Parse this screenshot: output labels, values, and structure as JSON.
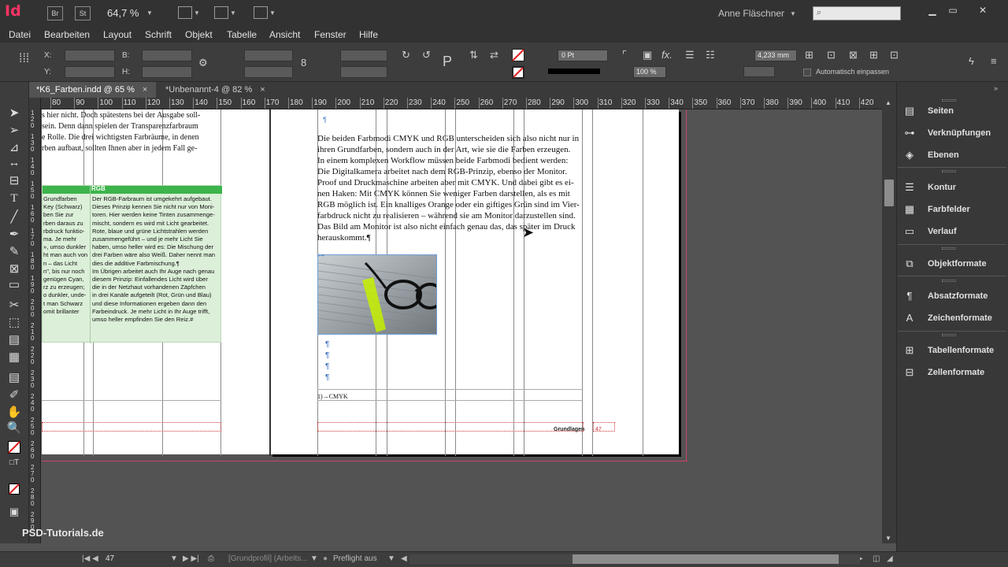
{
  "app": {
    "logo": "Id",
    "bridge_label": "Br",
    "stock_label": "St",
    "zoom": "64,7 %",
    "user": "Anne Fläschner"
  },
  "menu": [
    "Datei",
    "Bearbeiten",
    "Layout",
    "Schrift",
    "Objekt",
    "Tabelle",
    "Ansicht",
    "Fenster",
    "Hilfe"
  ],
  "control": {
    "x_label": "X:",
    "y_label": "Y:",
    "b_label": "B:",
    "h_label": "H:",
    "stroke_value": "0 Pt",
    "percent_value": "100 %",
    "size_value": "4,233 mm",
    "auto_fit_label": "Automatisch einpassen"
  },
  "tabs": [
    {
      "label": "*K6_Farben.indd @ 65 %",
      "active": true
    },
    {
      "label": "*Unbenannt-4 @ 82 %",
      "active": false
    }
  ],
  "ruler_h": [
    "80",
    "90",
    "100",
    "110",
    "120",
    "130",
    "140",
    "150",
    "160",
    "170",
    "180",
    "190",
    "200",
    "210",
    "220",
    "230",
    "240",
    "250",
    "260",
    "270",
    "280",
    "290",
    "300",
    "310",
    "320",
    "330",
    "340",
    "350",
    "360",
    "370",
    "380",
    "390",
    "400",
    "410",
    "420"
  ],
  "ruler_v": [
    "1 2 0",
    "1 3 0",
    "1 4 0",
    "1 5 0",
    "1 6 0",
    "1 7 0",
    "1 8 0",
    "1 9 0",
    "2 0 0",
    "2 1 0",
    "2 2 0",
    "2 3 0",
    "2 4 0",
    "2 5 0",
    "2 6 0",
    "2 7 0",
    "2 8 0",
    "2 9 0"
  ],
  "left_page": {
    "lines": [
      "s hier nicht. Doch spätestens bei der Ausgabe soll-",
      "sein. Denn dann spielen der Transparenzfarbraum",
      "e Rolle. Die drei wichtigsten Farbräume, in denen",
      "rben aufbaut, sollten Ihnen aber in jedem Fall ge-"
    ],
    "table_header": "RGB",
    "table_left": [
      "Grundfarben",
      "Key (Schwarz)",
      "ben Sie zur",
      "rben daraus zu",
      "rbdruck funktio-",
      "ma. Je mehr",
      "», umso dunkler",
      "ht man auch von",
      "n – das Licht",
      "n\", bis nur noch",
      "genügen Cyan,",
      "rz zu erzeugen;",
      "o dunkler, unde-",
      "t man Schwarz",
      "omit brillanter"
    ],
    "table_right": [
      "Der RGB-Farbraum ist umgekehrt aufgebaut.",
      "Dieses Prinzip kennen Sie nicht nur von Moni-",
      "toren. Hier werden keine Tinten zusammenge-",
      "mischt, sondern es wird mit Licht gearbeitet.",
      "Rote, blaue und grüne Lichtstrahlen werden",
      "zusammengeführt – und je mehr Licht Sie",
      "haben, umso heller wird es: Die Mischung der",
      "drei Farben wäre also Weiß. Daher nennt man",
      "dies die additive Farbmischung.¶",
      "Im Übrigen arbeitet auch Ihr Auge nach genau",
      "diesem Prinzip: Einfallendes Licht wird über",
      "die in der Netzhaut vorhandenen Zäpfchen",
      "in drei Kanäle aufgeteilt (Rot, Grün und Blau)",
      "und diese Informationen ergeben dann den",
      "Farbeindruck. Je mehr Licht in Ihr Auge trifft,",
      "umso heller empfinden Sie den Reiz.#"
    ]
  },
  "right_page": {
    "lines": [
      "Die beiden Farbmodi CMYK und RGB unterscheiden sich also nicht nur in",
      "ihren Grundfarben, sondern auch in der Art, wie sie die Farben erzeugen.",
      "In einem komplexen Workflow müssen beide Farbmodi bedient werden:",
      "Die Digitalkamera arbeitet nach dem RGB-Prinzip, ebenso der Monitor.",
      "Proof und Druckmaschine arbeiten aber mit CMYK. Und dabei gibt es ei-",
      "nen Haken: Mit CMYK können Sie weniger Farben darstellen, als es mit",
      "RGB möglich ist. Ein knalliges Orange oder ein giftiges Grün sind im Vier-",
      "farbdruck nicht zu realisieren – während sie am Monitor darzustellen sind.",
      "Das Bild am Monitor ist also nicht einfach genau das, das später im Druck",
      "herauskommt.¶"
    ],
    "caption": "1)→CMYK",
    "footer_label": "Grundlagen",
    "page_number": "47"
  },
  "panels": [
    {
      "label": "Seiten",
      "icon": "pages-icon"
    },
    {
      "label": "Verknüpfungen",
      "icon": "links-icon"
    },
    {
      "label": "Ebenen",
      "icon": "layers-icon"
    },
    {
      "label": "Kontur",
      "icon": "stroke-icon"
    },
    {
      "label": "Farbfelder",
      "icon": "swatches-icon"
    },
    {
      "label": "Verlauf",
      "icon": "gradient-icon"
    },
    {
      "label": "Objektformate",
      "icon": "object-styles-icon"
    },
    {
      "label": "Absatzformate",
      "icon": "paragraph-styles-icon"
    },
    {
      "label": "Zeichenformate",
      "icon": "character-styles-icon"
    },
    {
      "label": "Tabellenformate",
      "icon": "table-styles-icon"
    },
    {
      "label": "Zellenformate",
      "icon": "cell-styles-icon"
    }
  ],
  "status": {
    "page": "47",
    "profile": "[Grundprofil] (Arbeits...",
    "preflight": "Preflight aus",
    "watermark": "PSD-Tutorials.de"
  },
  "colors": {
    "accent_green": "#3cb44b",
    "table_fill": "#dcefd9",
    "bleed_line": "#d0406a"
  }
}
